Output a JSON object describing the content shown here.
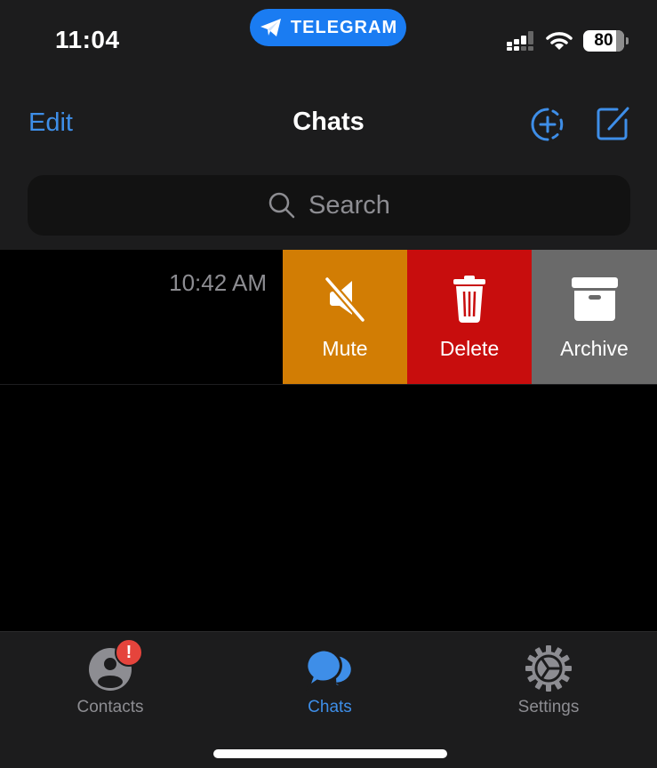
{
  "status_bar": {
    "time": "11:04",
    "app_pill_label": "TELEGRAM",
    "battery_percent": "80",
    "signal_bars_active": 3,
    "signal_bars_total": 4,
    "battery_level": 0.8
  },
  "nav": {
    "edit_label": "Edit",
    "title": "Chats"
  },
  "search": {
    "placeholder": "Search"
  },
  "chat_row": {
    "time": "10:42 AM",
    "actions": [
      {
        "label": "Mute",
        "icon": "speaker-mute-icon",
        "color": "#d27d04"
      },
      {
        "label": "Delete",
        "icon": "trash-icon",
        "color": "#c80d0d"
      },
      {
        "label": "Archive",
        "icon": "archive-box-icon",
        "color": "#6a6a6a"
      }
    ]
  },
  "tabbar": {
    "tabs": [
      {
        "label": "Contacts",
        "icon": "person-circle-icon",
        "badge": "!",
        "active": false
      },
      {
        "label": "Chats",
        "icon": "chat-bubbles-icon",
        "active": true
      },
      {
        "label": "Settings",
        "icon": "gear-icon",
        "active": false
      }
    ]
  },
  "colors": {
    "accent": "#3e8ee8",
    "telegram_blue": "#1a7cf2",
    "badge_red": "#e5443c",
    "background": "#000000",
    "header_bg": "#1c1c1d"
  }
}
